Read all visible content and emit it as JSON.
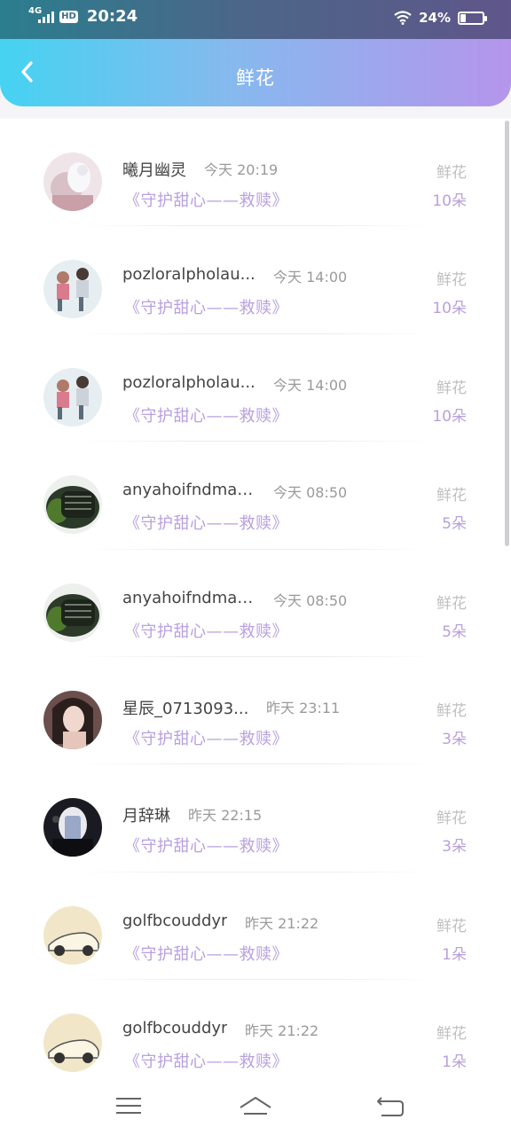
{
  "status": {
    "network": "4G",
    "hd": "HD",
    "time": "20:24",
    "battery": "24%",
    "battery_level": 0.24
  },
  "header": {
    "title": "鲜花"
  },
  "gifts": [
    {
      "name": "曦月幽灵",
      "time": "今天 20:19",
      "gift": "《守护甜心——救赎》",
      "type": "鲜花",
      "count": "10朵"
    },
    {
      "name": "pozloralpholau...",
      "time": "今天 14:00",
      "gift": "《守护甜心——救赎》",
      "type": "鲜花",
      "count": "10朵"
    },
    {
      "name": "pozloralpholau...",
      "time": "今天 14:00",
      "gift": "《守护甜心——救赎》",
      "type": "鲜花",
      "count": "10朵"
    },
    {
      "name": "anyahoifndmar...",
      "time": "今天 08:50",
      "gift": "《守护甜心——救赎》",
      "type": "鲜花",
      "count": "5朵"
    },
    {
      "name": "anyahoifndmar...",
      "time": "今天 08:50",
      "gift": "《守护甜心——救赎》",
      "type": "鲜花",
      "count": "5朵"
    },
    {
      "name": "星辰_0713093...",
      "time": "昨天 23:11",
      "gift": "《守护甜心——救赎》",
      "type": "鲜花",
      "count": "3朵"
    },
    {
      "name": "月辞琳",
      "time": "昨天 22:15",
      "gift": "《守护甜心——救赎》",
      "type": "鲜花",
      "count": "3朵"
    },
    {
      "name": "golfbcouddyr",
      "time": "昨天 21:22",
      "gift": "《守护甜心——救赎》",
      "type": "鲜花",
      "count": "1朵"
    },
    {
      "name": "golfbcouddyr",
      "time": "昨天 21:22",
      "gift": "《守护甜心——救赎》",
      "type": "鲜花",
      "count": "1朵"
    }
  ],
  "icons": {
    "back": "chevron-left-icon",
    "menu": "menu-icon",
    "home": "home-icon",
    "return": "return-icon"
  },
  "colors": {
    "accent": "#b99fe0",
    "header_start": "#45d3f2",
    "header_end": "#b595ec"
  }
}
